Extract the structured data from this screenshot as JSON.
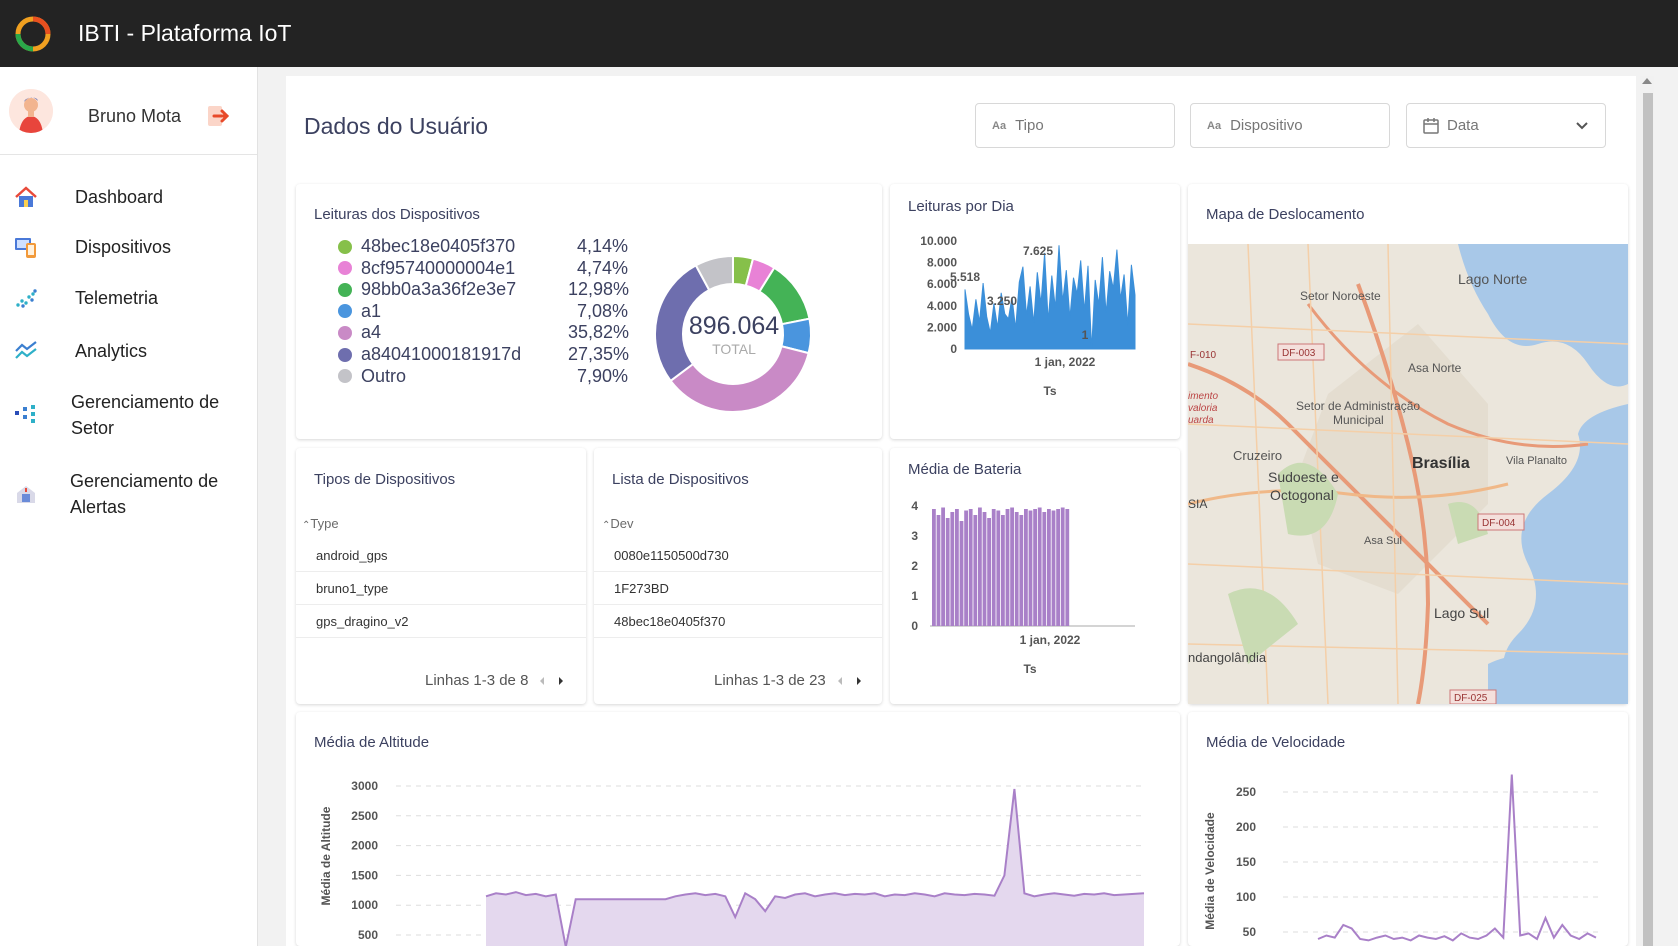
{
  "header": {
    "title": "IBTI - Plataforma IoT"
  },
  "user": {
    "name": "Bruno Mota"
  },
  "sidebar": {
    "items": [
      {
        "label": "Dashboard",
        "icon": "home-icon"
      },
      {
        "label": "Dispositivos",
        "icon": "devices-icon"
      },
      {
        "label": "Telemetria",
        "icon": "telemetry-icon"
      },
      {
        "label": "Analytics",
        "icon": "analytics-icon"
      },
      {
        "label": "Gerenciamento de",
        "label2": "Setor",
        "icon": "sector-icon"
      },
      {
        "label": "Gerenciamento de",
        "label2": "Alertas",
        "icon": "alerts-icon"
      }
    ]
  },
  "page": {
    "title": "Dados do Usuário"
  },
  "filters": {
    "tipo": "Tipo",
    "dispositivo": "Dispositivo",
    "data": "Data",
    "aa": "Aa"
  },
  "cards": {
    "leituras_dispositivos": {
      "title": "Leituras dos Dispositivos",
      "total": "896.064",
      "total_label": "TOTAL"
    },
    "leituras_dia": {
      "title": "Leituras por Dia",
      "xlabel": "Ts"
    },
    "mapa": {
      "title": "Mapa de Deslocamento"
    },
    "tipos": {
      "title": "Tipos de Dispositivos",
      "header": "Type",
      "rows": [
        "android_gps",
        "bruno1_type",
        "gps_dragino_v2"
      ],
      "pager": "Linhas 1-3 de 8"
    },
    "lista": {
      "title": "Lista de Dispositivos",
      "header": "Dev",
      "rows": [
        "0080e1150500d730",
        "1F273BD",
        "48bec18e0405f370"
      ],
      "pager": "Linhas 1-3 de 23"
    },
    "bateria": {
      "title": "Média de Bateria",
      "xlabel": "Ts"
    },
    "altitude": {
      "title": "Média de Altitude",
      "ylabel": "Média de Altitude"
    },
    "velocidade": {
      "title": "Média de Velocidade",
      "ylabel": "Média de Velocidade"
    }
  },
  "map_labels": {
    "lago_norte": "Lago Norte",
    "setor_noroeste": "Setor Noroeste",
    "df003": "DF-003",
    "f010": "F-010",
    "asa_norte": "Asa Norte",
    "setor_adm_1": "Setor de Administração",
    "setor_adm_2": "Municipal",
    "mento": "imento",
    "valoria": "valoria",
    "uarda": "uarda",
    "cruzeiro": "Cruzeiro",
    "brasilia": "Brasília",
    "vila_planalto": "Vila Planalto",
    "sudoeste_1": "Sudoeste e",
    "sudoeste_2": "Octogonal",
    "sia": "SIA",
    "df004": "DF-004",
    "asa_sul": "Asa Sul",
    "lago_sul": "Lago Sul",
    "ndangolandia": "ndangolândia",
    "df025": "DF-025"
  },
  "colors": {
    "accent": "#3c4160",
    "purple": "#a980c8",
    "blue": "#3b8fd9"
  },
  "chart_data": [
    {
      "type": "pie",
      "title": "Leituras dos Dispositivos",
      "categories": [
        "48bec18e0405f370",
        "8cf95740000004e1",
        "98bb0a3a36f2e3e7",
        "a1",
        "a4",
        "a84041000181917d",
        "Outro"
      ],
      "labels": [
        "4,14%",
        "4,74%",
        "12,98%",
        "7,08%",
        "35,82%",
        "27,35%",
        "7,90%"
      ],
      "values": [
        4.14,
        4.74,
        12.98,
        7.08,
        35.82,
        27.35,
        7.9
      ],
      "colors": [
        "#86c04a",
        "#e882d6",
        "#44b356",
        "#4a95de",
        "#c98ac6",
        "#6e6eae",
        "#c3c3c8"
      ]
    },
    {
      "type": "area",
      "title": "Leituras por Dia",
      "xlabel": "Ts",
      "x_tick": "1 jan, 2022",
      "y_ticks": [
        "10.000",
        "8.000",
        "6.000",
        "4.000",
        "2.000",
        "0"
      ],
      "ylim": [
        0,
        10000
      ],
      "annotations": [
        "5.518",
        "7.625",
        "3.250",
        "1"
      ],
      "values": [
        5518,
        3200,
        1800,
        4600,
        2500,
        6100,
        3000,
        1500,
        4200,
        2000,
        5200,
        3250,
        2800,
        4800,
        1900,
        6200,
        7625,
        3100,
        5800,
        2400,
        7100,
        4200,
        8900,
        2600,
        6800,
        3800,
        9600,
        4400,
        7300,
        2900,
        6600,
        5100,
        8200,
        3500,
        7700,
        1,
        6400,
        4100,
        8500,
        3300,
        7200,
        5600,
        9200,
        4600,
        6900,
        2200,
        7800,
        5000
      ]
    },
    {
      "type": "bar",
      "title": "Média de Bateria",
      "xlabel": "Ts",
      "x_tick": "1 jan, 2022",
      "y_ticks": [
        "4",
        "3",
        "2",
        "1",
        "0"
      ],
      "ylim": [
        0,
        4
      ],
      "values": [
        3.9,
        3.7,
        3.95,
        3.6,
        3.8,
        3.9,
        3.5,
        3.85,
        3.9,
        3.7,
        3.95,
        3.8,
        3.6,
        3.9,
        3.85,
        3.7,
        3.9,
        3.95,
        3.8,
        3.7,
        3.9,
        3.85,
        3.9,
        3.95,
        3.8,
        3.9,
        3.85,
        3.9,
        3.95,
        3.9
      ]
    },
    {
      "type": "area",
      "title": "Média de Altitude",
      "ylabel": "Média de Altitude",
      "y_ticks": [
        "3000",
        "2500",
        "2000",
        "1500",
        "1000",
        "500"
      ],
      "ylim": [
        500,
        3000
      ],
      "values": [
        1150,
        1200,
        1180,
        1220,
        1170,
        1190,
        1150,
        1180,
        300,
        1100,
        1100,
        1100,
        1100,
        1100,
        1100,
        1100,
        1100,
        1100,
        1100,
        1150,
        1180,
        1200,
        1170,
        1190,
        1150,
        800,
        1200,
        1100,
        900,
        1150,
        1120,
        1180,
        1200,
        1150,
        1180,
        1200,
        1170,
        1190,
        1180,
        1200,
        1150,
        1180,
        1170,
        1200,
        1180,
        1150,
        1200,
        1180,
        1170,
        1190,
        1180,
        1160,
        1500,
        2950,
        1200,
        1150,
        1180,
        1200,
        1180,
        1160,
        1190,
        1180,
        1200,
        1170,
        1180,
        1190,
        1200
      ]
    },
    {
      "type": "line",
      "title": "Média de Velocidade",
      "ylabel": "Média de Velocidade",
      "y_ticks": [
        "250",
        "200",
        "150",
        "100",
        "50"
      ],
      "ylim": [
        50,
        250
      ],
      "values": [
        40,
        45,
        42,
        60,
        55,
        40,
        38,
        42,
        45,
        40,
        42,
        38,
        45,
        42,
        40,
        44,
        38,
        48,
        42,
        40,
        45,
        55,
        42,
        275,
        45,
        48,
        40,
        70,
        42,
        60,
        45,
        40,
        48,
        42
      ]
    }
  ]
}
